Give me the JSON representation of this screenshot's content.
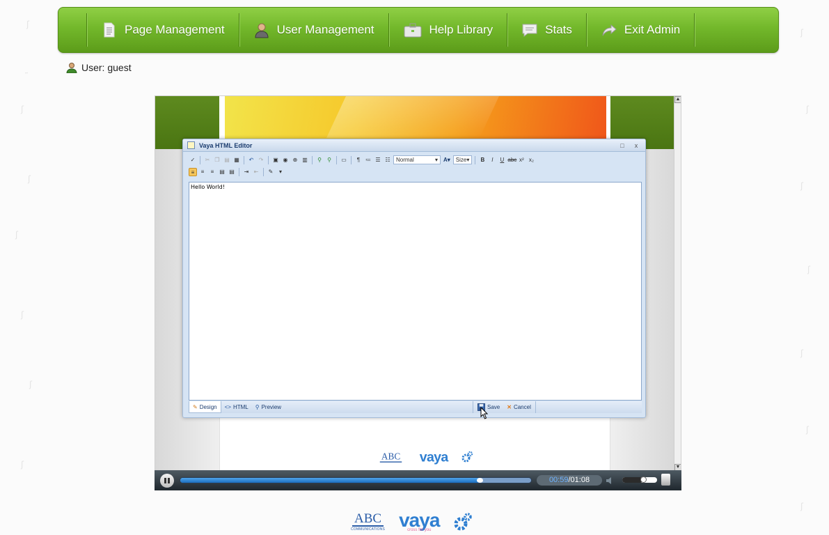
{
  "nav": {
    "items": [
      {
        "label": "Page Management",
        "icon": "page-icon"
      },
      {
        "label": "User Management",
        "icon": "user-icon"
      },
      {
        "label": "Help Library",
        "icon": "briefcase-icon"
      },
      {
        "label": "Stats",
        "icon": "chat-icon"
      },
      {
        "label": "Exit Admin",
        "icon": "exit-arrow-icon"
      }
    ]
  },
  "user": {
    "label": "User: guest"
  },
  "editor": {
    "title": "Vaya HTML Editor",
    "format_combo": "Normal",
    "size_combo": "Size",
    "content": "Hello World!",
    "modes": {
      "design": "Design",
      "html": "HTML",
      "preview": "Preview"
    },
    "save_label": "Save",
    "cancel_label": "Cancel"
  },
  "video": {
    "current_time": "00:59",
    "total_time": "01:08",
    "progress": 0.85,
    "volume": 0.6
  },
  "logos": {
    "abc_main": "ABC",
    "abc_sub": "COMMUNICATIONS",
    "vaya_main": "vaya",
    "vaya_sub": "cross for you"
  },
  "colors": {
    "nav_green": "#73b82b",
    "progress_blue": "#1b6fc0",
    "editor_blue": "#d6e4f4"
  }
}
